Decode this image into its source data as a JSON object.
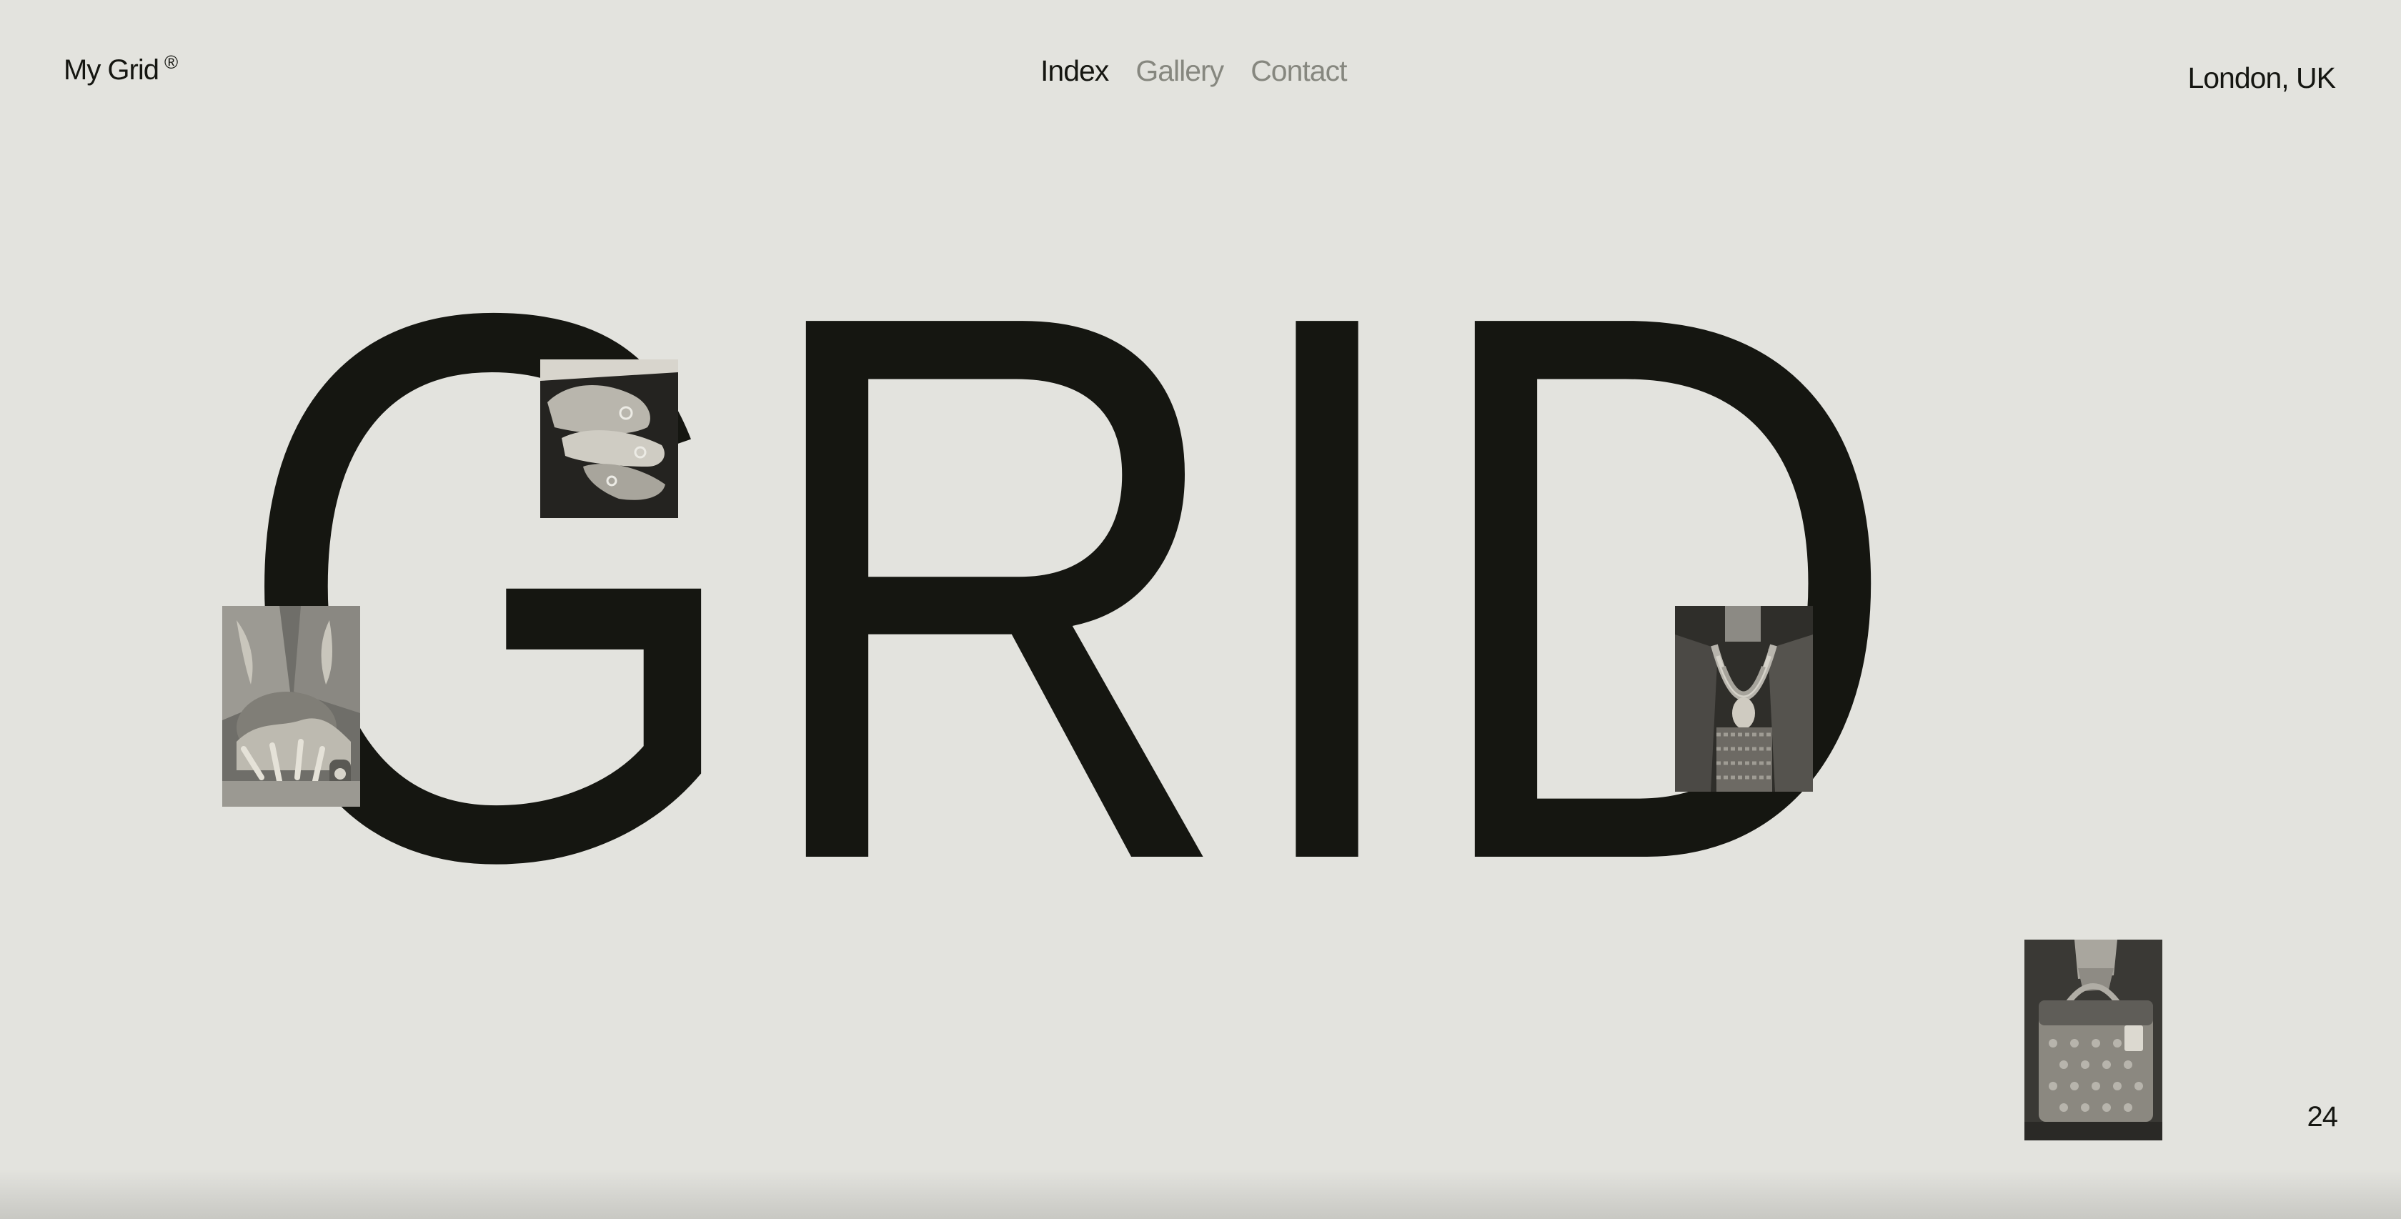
{
  "header": {
    "brand": "My Grid",
    "brand_mark": "®",
    "nav": [
      {
        "label": "Index",
        "active": true
      },
      {
        "label": "Gallery",
        "active": false
      },
      {
        "label": "Contact",
        "active": false
      }
    ],
    "location": "London, UK"
  },
  "hero": {
    "word": "GRID"
  },
  "footer": {
    "page_number": "24"
  },
  "photos": [
    {
      "subject": "hands-with-rings"
    },
    {
      "subject": "embroidered-jacket"
    },
    {
      "subject": "beaded-necklace-outfit"
    },
    {
      "subject": "monogram-handbag"
    }
  ],
  "colors": {
    "background": "#e3e3de",
    "ink": "#151611",
    "muted": "#86877f"
  }
}
